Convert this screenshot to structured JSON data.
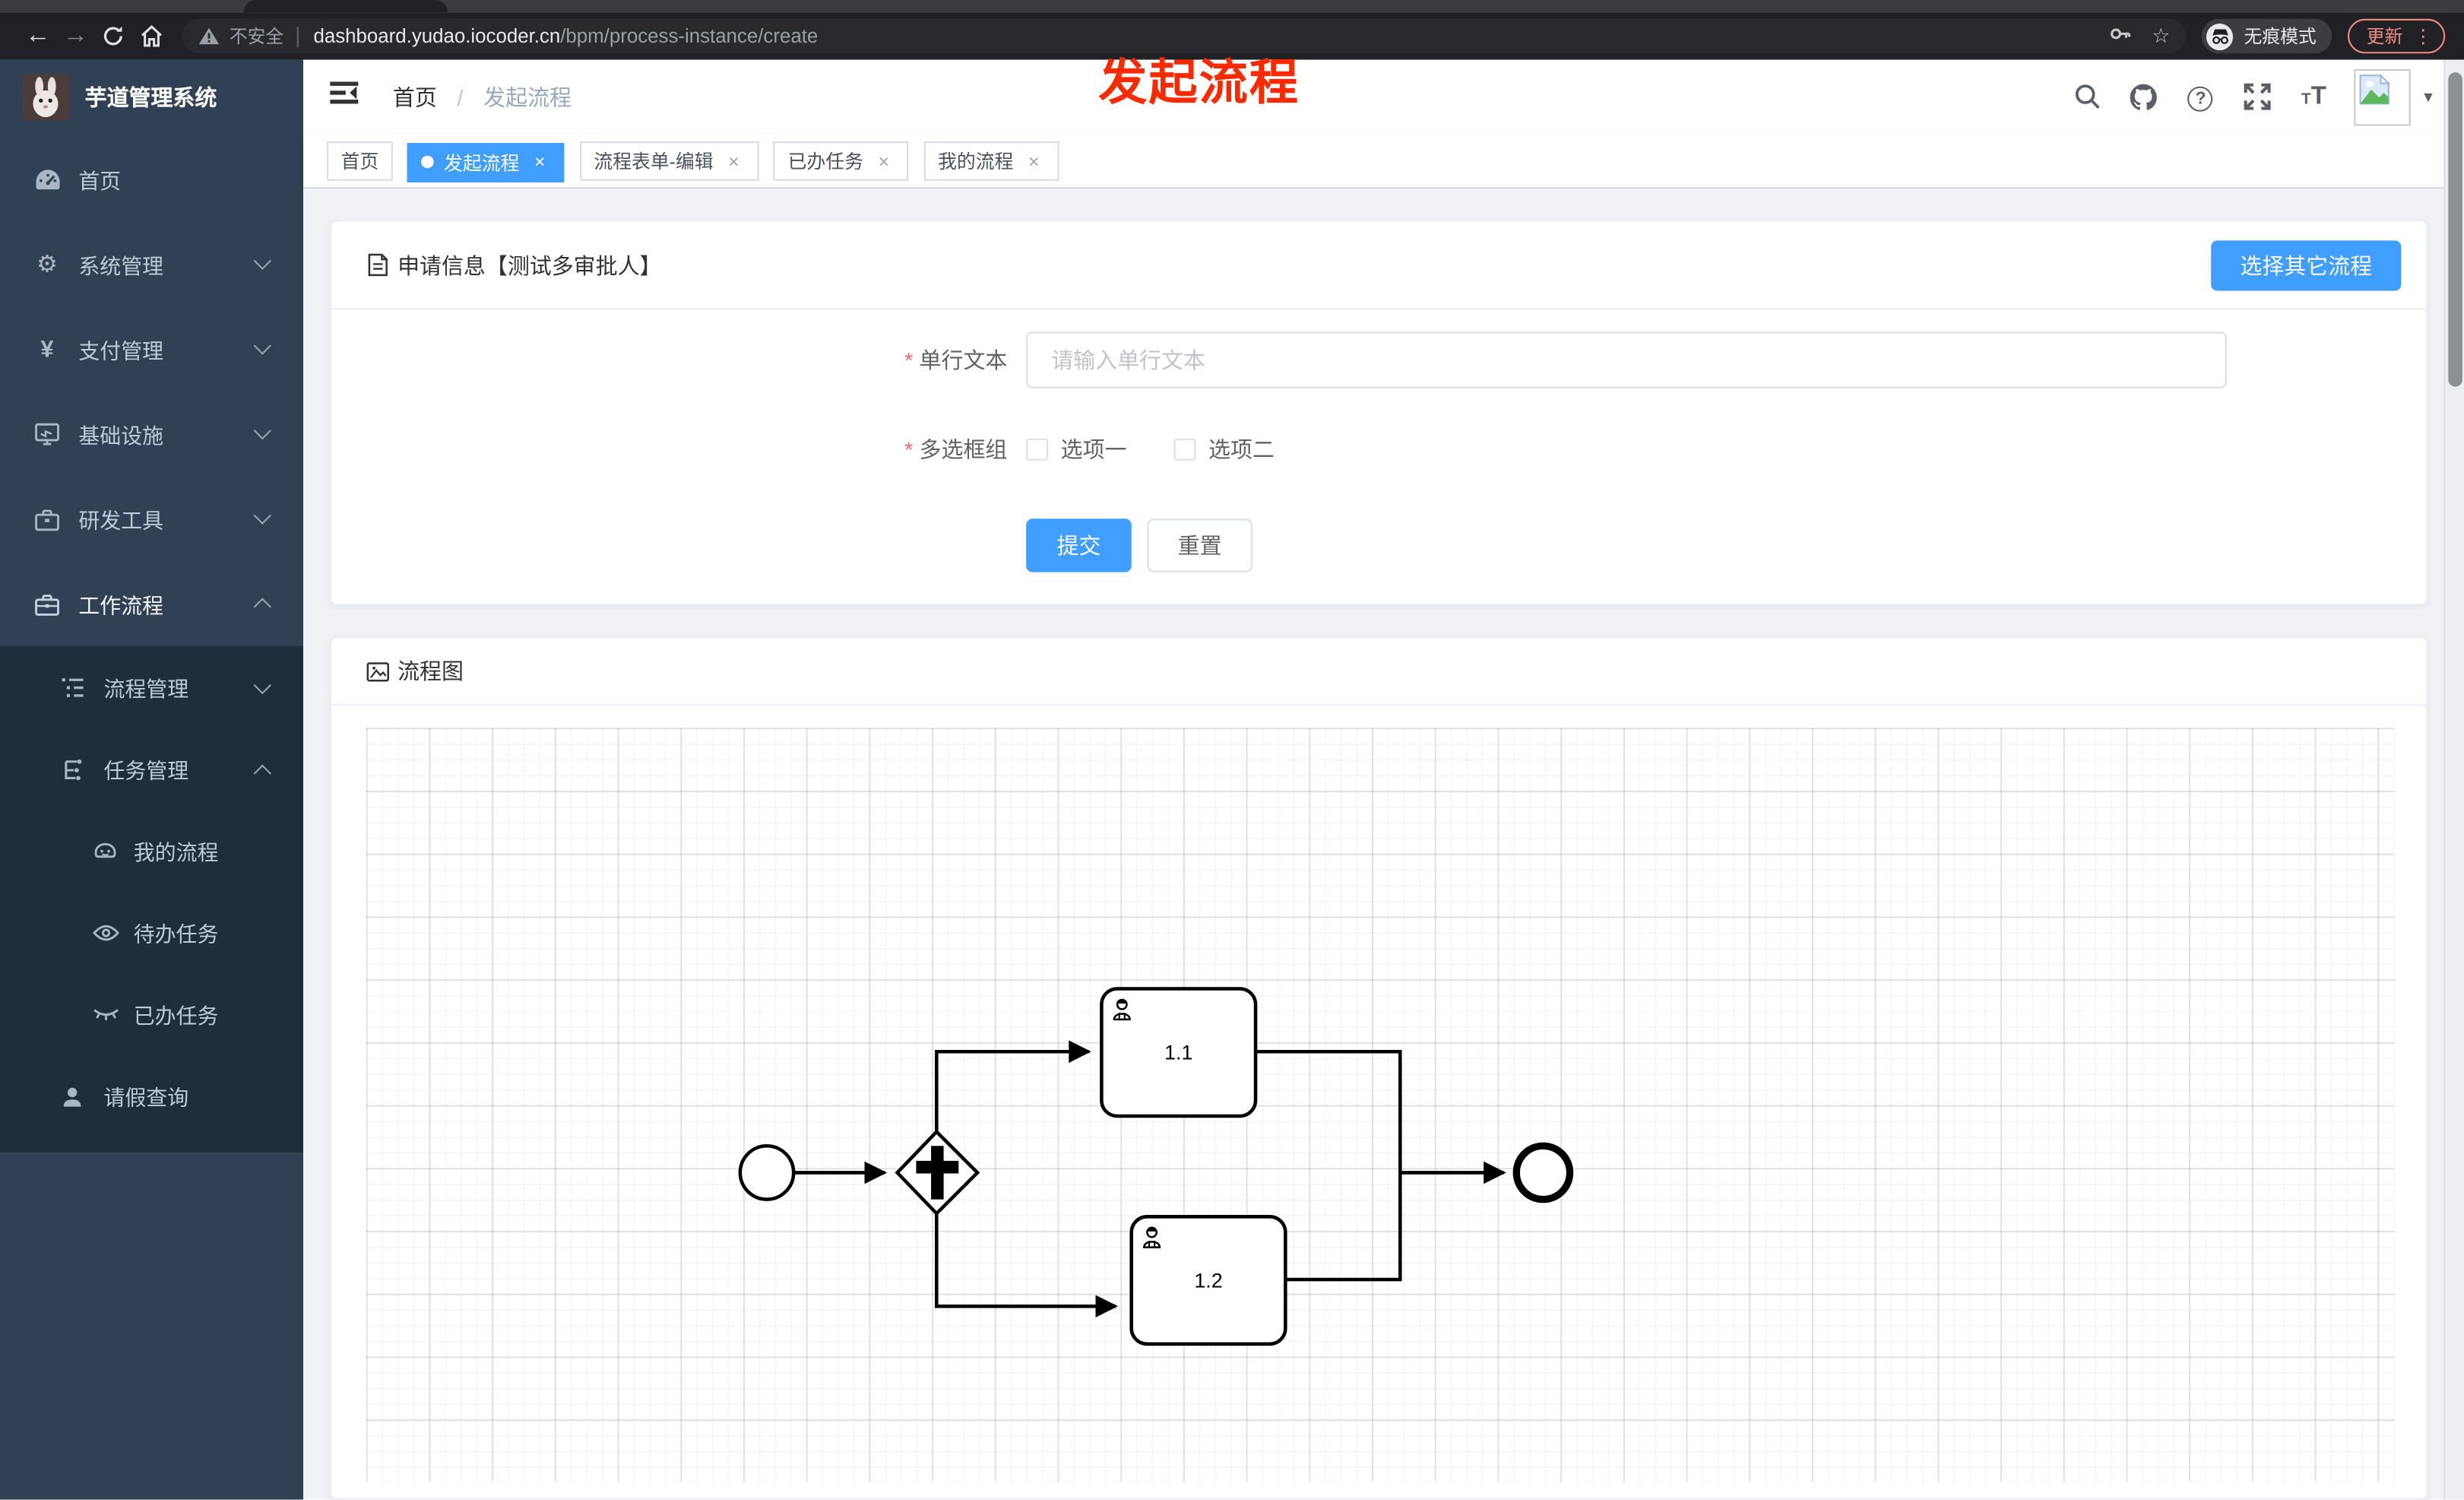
{
  "browser": {
    "security_label": "不安全",
    "url_host": "dashboard.yudao.iocoder.cn",
    "url_path": "/bpm/process-instance/create",
    "incognito_label": "无痕模式",
    "update_label": "更新"
  },
  "glyphs": {
    "back": "←",
    "forward": "→",
    "star": "☆",
    "menu_dots": "⋮",
    "caret_down": "▾",
    "gear": "⚙",
    "yen": "¥",
    "question": "?",
    "letter_t": "T"
  },
  "annotation": {
    "text": "发起流程",
    "color": "#fa2a00"
  },
  "sidebar": {
    "title": "芋道管理系统",
    "items": [
      {
        "label": "首页",
        "icon": "dashboard-icon"
      },
      {
        "label": "系统管理",
        "icon": "gear-icon",
        "chevron": "down"
      },
      {
        "label": "支付管理",
        "icon": "yen-icon",
        "chevron": "down"
      },
      {
        "label": "基础设施",
        "icon": "monitor-icon",
        "chevron": "down"
      },
      {
        "label": "研发工具",
        "icon": "toolbox-icon",
        "chevron": "down"
      },
      {
        "label": "工作流程",
        "icon": "briefcase-icon",
        "chevron": "up",
        "expanded": true
      }
    ],
    "submenu": [
      {
        "label": "流程管理",
        "icon": "flow-list-icon",
        "chevron": "down",
        "level": 1
      },
      {
        "label": "任务管理",
        "icon": "tree-icon",
        "chevron": "up",
        "level": 1
      },
      {
        "label": "我的流程",
        "icon": "robot-icon",
        "level": 2
      },
      {
        "label": "待办任务",
        "icon": "eye-open-icon",
        "level": 2
      },
      {
        "label": "已办任务",
        "icon": "eye-closed-icon",
        "level": 2
      },
      {
        "label": "请假查询",
        "icon": "user-icon",
        "level": 1
      }
    ]
  },
  "header": {
    "breadcrumb": [
      "首页",
      "发起流程"
    ],
    "separator": "/"
  },
  "tabs": {
    "close_glyph": "×",
    "items": [
      {
        "label": "首页",
        "active": false,
        "closable": false
      },
      {
        "label": "发起流程",
        "active": true,
        "closable": true
      },
      {
        "label": "流程表单-编辑",
        "active": false,
        "closable": true
      },
      {
        "label": "已办任务",
        "active": false,
        "closable": true
      },
      {
        "label": "我的流程",
        "active": false,
        "closable": true
      }
    ]
  },
  "form_card": {
    "title": "申请信息【测试多审批人】",
    "choose_other_label": "选择其它流程",
    "required_mark": "*",
    "text_field": {
      "label": "单行文本",
      "placeholder": "请输入单行文本",
      "value": ""
    },
    "checkbox_group": {
      "label": "多选框组",
      "options": [
        {
          "label": "选项一",
          "checked": false
        },
        {
          "label": "选项二",
          "checked": false
        }
      ]
    },
    "submit_label": "提交",
    "reset_label": "重置"
  },
  "flow_card": {
    "title": "流程图",
    "diagram": {
      "type": "bpmn",
      "nodes": [
        "start-event",
        "parallel-gateway",
        "user-task-1.1",
        "user-task-1.2",
        "end-event"
      ],
      "tasks": [
        {
          "label": "1.1"
        },
        {
          "label": "1.2"
        }
      ]
    }
  },
  "colors": {
    "primary": "#409eff",
    "sidebar_bg": "#304156",
    "submenu_bg": "#1f2d3d",
    "danger": "#f56c6c",
    "annotation": "#fa2a00",
    "toolbar_bg": "#202124",
    "update_accent": "#f28b82"
  }
}
